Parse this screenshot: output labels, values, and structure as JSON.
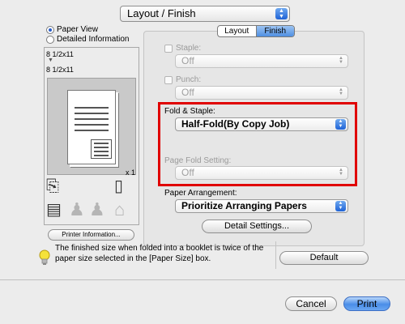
{
  "panel_selector": {
    "value": "Layout / Finish"
  },
  "view_options": [
    {
      "label": "Paper View",
      "selected": true
    },
    {
      "label": "Detailed Information",
      "selected": false
    }
  ],
  "preview": {
    "original_size": "8 1/2x11",
    "output_size": "8 1/2x11",
    "copies": "x 1"
  },
  "printer_info_button": "Printer Information...",
  "tabs": [
    {
      "label": "Layout",
      "selected": false
    },
    {
      "label": "Finish",
      "selected": true
    }
  ],
  "staple": {
    "label": "Staple:",
    "value": "Off",
    "enabled": false
  },
  "punch": {
    "label": "Punch:",
    "value": "Off",
    "enabled": false
  },
  "fold_staple": {
    "label": "Fold & Staple:",
    "value": "Half-Fold(By Copy Job)"
  },
  "page_fold_setting": {
    "label": "Page Fold Setting:",
    "value": "Off",
    "enabled": false
  },
  "paper_arrangement": {
    "label": "Paper Arrangement:",
    "value": "Prioritize Arranging Papers"
  },
  "detail_settings_button": "Detail Settings...",
  "info_message": "The finished size when folded into a booklet is twice of the paper size selected in the [Paper Size] box.",
  "default_button": "Default",
  "cancel_button": "Cancel",
  "print_button": "Print",
  "colors": {
    "accent_blue": "#2f7ae5",
    "highlight_red": "#e00000"
  }
}
